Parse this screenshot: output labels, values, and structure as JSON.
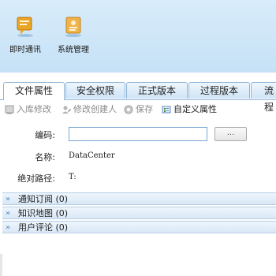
{
  "topbar": {
    "tools": [
      {
        "label": "即时通讯",
        "icon": "chat-icon"
      },
      {
        "label": "系统管理",
        "icon": "system-admin-icon"
      }
    ]
  },
  "tabs": [
    "文件属性",
    "安全权限",
    "正式版本",
    "过程版本",
    "流程"
  ],
  "toolbar": {
    "checkin": "入库修改",
    "modify_creator": "修改创建人",
    "save": "保存",
    "custom_attr": "自定义属性"
  },
  "form": {
    "code_label": "编码:",
    "code_value": "",
    "browse_label": "...",
    "name_label": "名称:",
    "name_value": "DataCenter",
    "path_label": "绝对路径:",
    "path_value": "T:"
  },
  "panels": [
    {
      "label": "通知订阅 (0)"
    },
    {
      "label": "知识地图 (0)"
    },
    {
      "label": "用户评论 (0)"
    }
  ],
  "colors": {
    "accent": "#8fb4d6",
    "toolbar_bg": "#c6e1f6"
  }
}
